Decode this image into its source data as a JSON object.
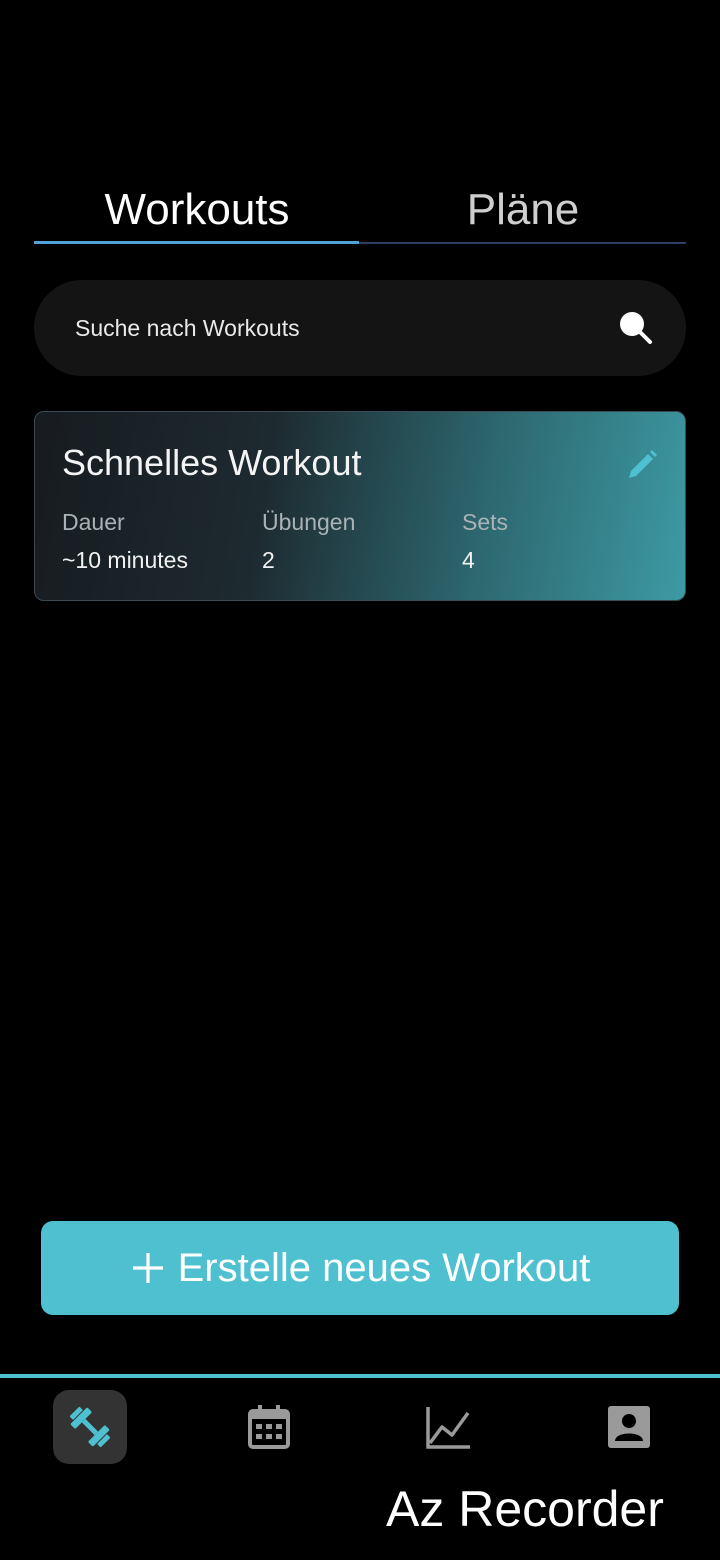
{
  "tabs": {
    "workouts_label": "Workouts",
    "plans_label": "Pläne",
    "active": "Workouts"
  },
  "search": {
    "placeholder": "Suche nach Workouts",
    "icon": "search-icon"
  },
  "workout_card": {
    "title": "Schnelles Workout",
    "edit_icon": "pencil-icon",
    "stats": [
      {
        "label": "Dauer",
        "value": "~10 minutes"
      },
      {
        "label": "Übungen",
        "value": "2"
      },
      {
        "label": "Sets",
        "value": "4"
      }
    ]
  },
  "create_button": {
    "label": "Erstelle neues Workout",
    "icon": "plus-icon"
  },
  "bottom_nav": {
    "items": [
      {
        "name": "workouts",
        "icon": "dumbbell-icon",
        "active": true
      },
      {
        "name": "calendar",
        "icon": "calendar-icon",
        "active": false
      },
      {
        "name": "progress",
        "icon": "chart-icon",
        "active": false
      },
      {
        "name": "profile",
        "icon": "profile-icon",
        "active": false
      }
    ]
  },
  "watermark": "Az Recorder",
  "colors": {
    "accent": "#4ec0d0",
    "background": "#000000",
    "tab_indicator": "#4fa3d6",
    "search_background": "#141414"
  }
}
